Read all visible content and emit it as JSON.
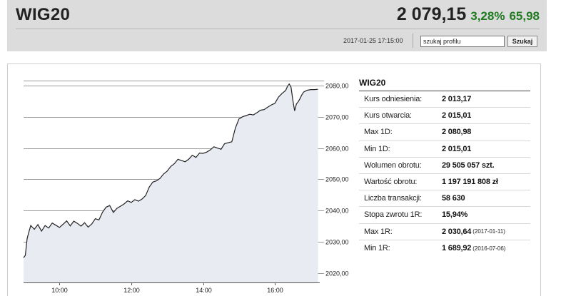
{
  "header": {
    "title": "WIG20",
    "price": "2 079,15",
    "change_pct": "3,28%",
    "change_abs": "65,98",
    "timestamp": "2017-01-25 17:15:00",
    "search_placeholder": "szukaj profilu",
    "search_button": "Szukaj"
  },
  "colors": {
    "positive": "#1f7a1f",
    "chart_line": "#222222",
    "chart_fill": "#e8ebf2",
    "grid": "#9a9a9a"
  },
  "stats": {
    "title": "WIG20",
    "rows": [
      {
        "label": "Kurs odniesienia:",
        "value": "2 013,17",
        "note": ""
      },
      {
        "label": "Kurs otwarcia:",
        "value": "2 015,01",
        "note": ""
      },
      {
        "label": "Max 1D:",
        "value": "2 080,98",
        "note": ""
      },
      {
        "label": "Min 1D:",
        "value": "2 015,01",
        "note": ""
      },
      {
        "label": "Wolumen obrotu:",
        "value": "29 505 057 szt.",
        "note": ""
      },
      {
        "label": "Wartość obrotu:",
        "value": "1 197 191 808 zł",
        "note": ""
      },
      {
        "label": "Liczba transakcji:",
        "value": "58 630",
        "note": ""
      },
      {
        "label": "Stopa zwrotu 1R:",
        "value": "15,94%",
        "note": ""
      },
      {
        "label": "Max 1R:",
        "value": "2 030,64",
        "note": "(2017-01-11)"
      },
      {
        "label": "Min 1R:",
        "value": "1 689,92",
        "note": "(2016-07-06)"
      }
    ]
  },
  "chart_data": {
    "type": "area",
    "x_ticks": [
      10,
      12,
      14,
      16
    ],
    "x_tick_labels": [
      "10:00",
      "12:00",
      "14:00",
      "16:00"
    ],
    "xlim": [
      9.0,
      17.25
    ],
    "y_ticks": [
      2020,
      2030,
      2040,
      2050,
      2060,
      2070,
      2080
    ],
    "y_tick_labels": [
      "2020,00",
      "2030,00",
      "2040,00",
      "2050,00",
      "2060,00",
      "2070,00",
      "2080,00"
    ],
    "ylim": [
      2017,
      2085
    ],
    "grid": true,
    "points": [
      [
        9.0,
        2024.9
      ],
      [
        9.05,
        2025.7
      ],
      [
        9.1,
        2031.0
      ],
      [
        9.15,
        2033.2
      ],
      [
        9.2,
        2035.2
      ],
      [
        9.3,
        2034.0
      ],
      [
        9.4,
        2035.5
      ],
      [
        9.5,
        2033.4
      ],
      [
        9.6,
        2035.2
      ],
      [
        9.7,
        2034.4
      ],
      [
        9.8,
        2036.0
      ],
      [
        9.9,
        2035.3
      ],
      [
        10.0,
        2034.6
      ],
      [
        10.1,
        2035.6
      ],
      [
        10.2,
        2036.7
      ],
      [
        10.3,
        2035.1
      ],
      [
        10.4,
        2036.6
      ],
      [
        10.5,
        2035.9
      ],
      [
        10.6,
        2035.0
      ],
      [
        10.7,
        2036.1
      ],
      [
        10.8,
        2034.7
      ],
      [
        10.9,
        2035.7
      ],
      [
        11.0,
        2037.4
      ],
      [
        11.1,
        2037.0
      ],
      [
        11.2,
        2039.5
      ],
      [
        11.3,
        2041.1
      ],
      [
        11.4,
        2041.6
      ],
      [
        11.5,
        2039.4
      ],
      [
        11.6,
        2040.7
      ],
      [
        11.7,
        2041.4
      ],
      [
        11.8,
        2042.1
      ],
      [
        11.9,
        2043.1
      ],
      [
        12.0,
        2042.6
      ],
      [
        12.1,
        2043.5
      ],
      [
        12.2,
        2043.0
      ],
      [
        12.3,
        2043.7
      ],
      [
        12.4,
        2044.8
      ],
      [
        12.5,
        2047.5
      ],
      [
        12.6,
        2049.1
      ],
      [
        12.7,
        2049.5
      ],
      [
        12.8,
        2050.3
      ],
      [
        12.9,
        2051.7
      ],
      [
        13.0,
        2052.6
      ],
      [
        13.1,
        2054.1
      ],
      [
        13.2,
        2055.0
      ],
      [
        13.3,
        2056.4
      ],
      [
        13.4,
        2056.0
      ],
      [
        13.5,
        2055.6
      ],
      [
        13.6,
        2056.4
      ],
      [
        13.7,
        2057.7
      ],
      [
        13.8,
        2057.0
      ],
      [
        13.9,
        2058.4
      ],
      [
        14.0,
        2058.3
      ],
      [
        14.1,
        2058.7
      ],
      [
        14.2,
        2059.4
      ],
      [
        14.3,
        2060.4
      ],
      [
        14.4,
        2060.0
      ],
      [
        14.5,
        2059.6
      ],
      [
        14.6,
        2061.4
      ],
      [
        14.7,
        2061.7
      ],
      [
        14.8,
        2062.0
      ],
      [
        14.9,
        2066.4
      ],
      [
        15.0,
        2069.3
      ],
      [
        15.1,
        2070.0
      ],
      [
        15.2,
        2070.4
      ],
      [
        15.3,
        2070.8
      ],
      [
        15.4,
        2070.6
      ],
      [
        15.5,
        2071.3
      ],
      [
        15.6,
        2072.1
      ],
      [
        15.7,
        2072.3
      ],
      [
        15.8,
        2073.1
      ],
      [
        15.9,
        2073.8
      ],
      [
        16.0,
        2074.3
      ],
      [
        16.1,
        2076.3
      ],
      [
        16.2,
        2077.5
      ],
      [
        16.3,
        2078.4
      ],
      [
        16.35,
        2079.7
      ],
      [
        16.4,
        2080.5
      ],
      [
        16.45,
        2079.4
      ],
      [
        16.5,
        2075.3
      ],
      [
        16.55,
        2071.9
      ],
      [
        16.6,
        2074.1
      ],
      [
        16.65,
        2074.8
      ],
      [
        16.7,
        2075.8
      ],
      [
        16.75,
        2077.0
      ],
      [
        16.8,
        2077.9
      ],
      [
        16.9,
        2078.5
      ],
      [
        17.0,
        2078.7
      ],
      [
        17.1,
        2078.7
      ],
      [
        17.2,
        2078.8
      ]
    ]
  }
}
